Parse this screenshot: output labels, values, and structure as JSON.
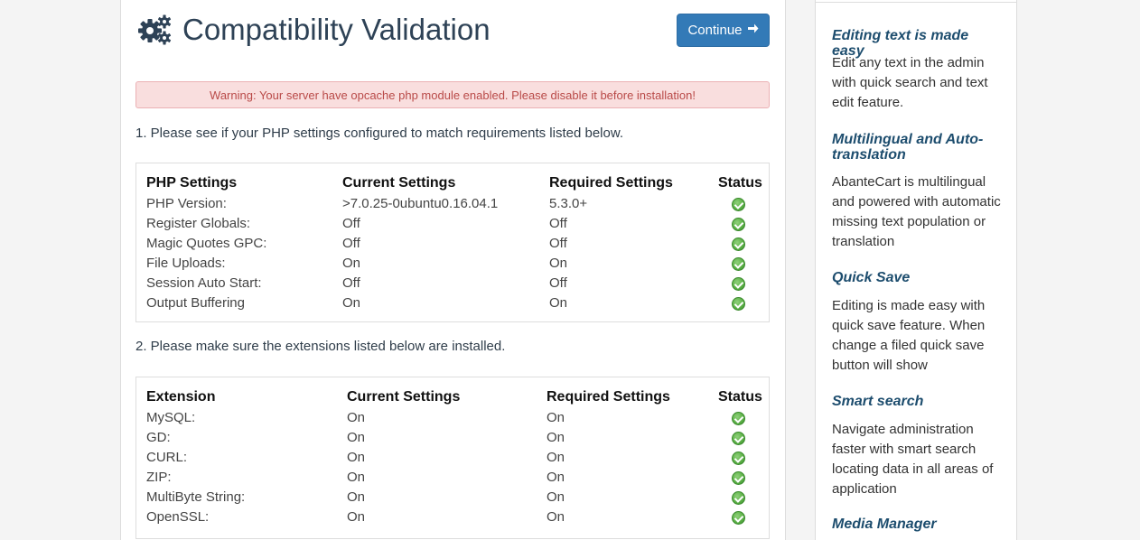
{
  "header": {
    "title": "Compatibility Validation",
    "continue_label": "Continue",
    "continue_icon": "arrow-right-icon"
  },
  "warning": "Warning: Your server have opcache php module enabled. Please disable it before installation!",
  "php_section": {
    "intro": "1. Please see if your PHP settings configured to match requirements listed below.",
    "columns": [
      "PHP Settings",
      "Current Settings",
      "Required Settings",
      "Status"
    ],
    "rows": [
      {
        "name": "PHP Version:",
        "current": ">7.0.25-0ubuntu0.16.04.1",
        "required": "5.3.0+",
        "status": "ok"
      },
      {
        "name": "Register Globals:",
        "current": "Off",
        "required": "Off",
        "status": "ok"
      },
      {
        "name": "Magic Quotes GPC:",
        "current": "Off",
        "required": "Off",
        "status": "ok"
      },
      {
        "name": "File Uploads:",
        "current": "On",
        "required": "On",
        "status": "ok"
      },
      {
        "name": "Session Auto Start:",
        "current": "Off",
        "required": "Off",
        "status": "ok"
      },
      {
        "name": "Output Buffering",
        "current": "On",
        "required": "On",
        "status": "ok"
      }
    ]
  },
  "ext_section": {
    "intro": "2. Please make sure the extensions listed below are installed.",
    "columns": [
      "Extension",
      "Current Settings",
      "Required Settings",
      "Status"
    ],
    "rows": [
      {
        "name": "MySQL:",
        "current": "On",
        "required": "On",
        "status": "ok"
      },
      {
        "name": "GD:",
        "current": "On",
        "required": "On",
        "status": "ok"
      },
      {
        "name": "CURL:",
        "current": "On",
        "required": "On",
        "status": "ok"
      },
      {
        "name": "ZIP:",
        "current": "On",
        "required": "On",
        "status": "ok"
      },
      {
        "name": "MultiByte String:",
        "current": "On",
        "required": "On",
        "status": "ok"
      },
      {
        "name": "OpenSSL:",
        "current": "On",
        "required": "On",
        "status": "ok"
      }
    ]
  },
  "sidebar": {
    "features": [
      {
        "title": "Editing text is made easy",
        "text": "Edit any text in the admin with quick search and text edit feature."
      },
      {
        "title": "Multilingual and Auto-translation",
        "text": "AbanteCart is multilingual and powered with automatic missing text population or translation"
      },
      {
        "title": "Quick Save",
        "text": "Editing is made easy with quick save feature. When change a filed quick save button will show"
      },
      {
        "title": "Smart search",
        "text": "Navigate administration faster with smart search locating data in all areas of application"
      },
      {
        "title": "Media Manager",
        "text": ""
      }
    ]
  },
  "colors": {
    "title": "#2e4256",
    "button": "#337ab7",
    "warning_bg": "#f9dede",
    "warning_text": "#b94a48",
    "sidebar_heading": "#1d4d6e",
    "status_ok": "#5cb147"
  },
  "icons": {
    "title": "gears-icon",
    "status_ok": "check-circle-icon"
  }
}
